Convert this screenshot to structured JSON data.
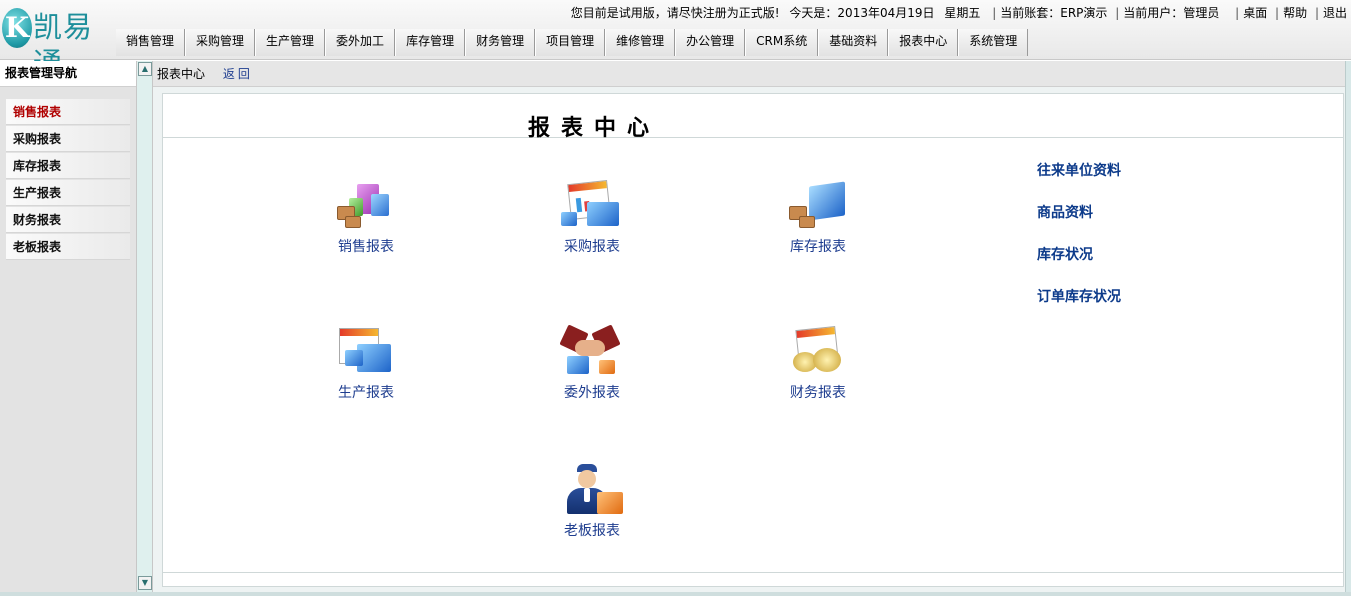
{
  "app": {
    "logo_letter": "K",
    "logo_text": "凯易通"
  },
  "topinfo": {
    "notice": "您目前是试用版，请尽快注册为正式版!",
    "today_label": "今天是：",
    "date": "2013年04月19日",
    "weekday": "星期五",
    "account_label": "当前账套：",
    "account": "ERP演示",
    "user_label": "当前用户：",
    "user": "管理员",
    "desktop": "桌面",
    "help": "帮助",
    "logout": "退出",
    "separator": "|"
  },
  "menu": [
    "销售管理",
    "采购管理",
    "生产管理",
    "委外加工",
    "库存管理",
    "财务管理",
    "项目管理",
    "维修管理",
    "办公管理",
    "CRM系统",
    "基础资料",
    "报表中心",
    "系统管理"
  ],
  "leftnav": {
    "title": "报表管理导航",
    "items": [
      {
        "label": "销售报表",
        "active": true
      },
      {
        "label": "采购报表",
        "active": false
      },
      {
        "label": "库存报表",
        "active": false
      },
      {
        "label": "生产报表",
        "active": false
      },
      {
        "label": "财务报表",
        "active": false
      },
      {
        "label": "老板报表",
        "active": false
      }
    ]
  },
  "breadcrumb": {
    "current": "报表中心",
    "back": "返回"
  },
  "panel": {
    "title": "报表中心",
    "tiles": {
      "sales": "销售报表",
      "purchase": "采购报表",
      "inventory": "库存报表",
      "production": "生产报表",
      "outsource": "委外报表",
      "finance": "财务报表",
      "boss": "老板报表"
    },
    "quicklinks": [
      "往来单位资料",
      "商品资料",
      "库存状况",
      "订单库存状况"
    ]
  },
  "colors": {
    "link_blue": "#1e3d8f",
    "quicklink_blue": "#0c3a8a",
    "active_nav_red": "#b00000",
    "logo_teal": "#1e8f9b"
  }
}
